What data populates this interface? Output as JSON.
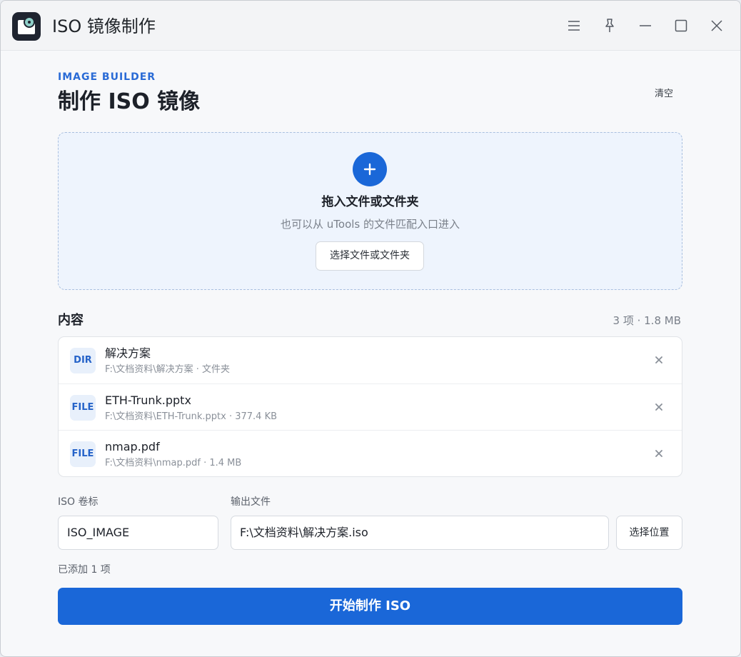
{
  "window": {
    "title": "ISO 镜像制作",
    "controls": [
      "menu-icon",
      "pin-icon",
      "minimize-icon",
      "maximize-icon",
      "close-icon"
    ]
  },
  "header": {
    "eyebrow": "IMAGE BUILDER",
    "title": "制作 ISO 镜像",
    "clear_label": "清空"
  },
  "dropzone": {
    "title": "拖入文件或文件夹",
    "subtitle": "也可以从 uTools 的文件匹配入口进入",
    "pick_label": "选择文件或文件夹"
  },
  "content": {
    "title": "内容",
    "summary": "3 项 · 1.8 MB",
    "items": [
      {
        "badge": "DIR",
        "name": "解决方案",
        "meta": "F:\\文档资料\\解决方案 · 文件夹"
      },
      {
        "badge": "FILE",
        "name": "ETH-Trunk.pptx",
        "meta": "F:\\文档资料\\ETH-Trunk.pptx · 377.4 KB"
      },
      {
        "badge": "FILE",
        "name": "nmap.pdf",
        "meta": "F:\\文档资料\\nmap.pdf · 1.4 MB"
      }
    ]
  },
  "form": {
    "volume_label": "ISO 卷标",
    "volume_value": "ISO_IMAGE",
    "output_label": "输出文件",
    "output_value": "F:\\文档资料\\解决方案.iso",
    "choose_label": "选择位置"
  },
  "status": "已添加 1 项",
  "start_label": "开始制作 ISO",
  "colors": {
    "accent": "#1a67d8",
    "dropzone_bg": "#eef4fd",
    "badge_bg": "#e8f0fb"
  }
}
